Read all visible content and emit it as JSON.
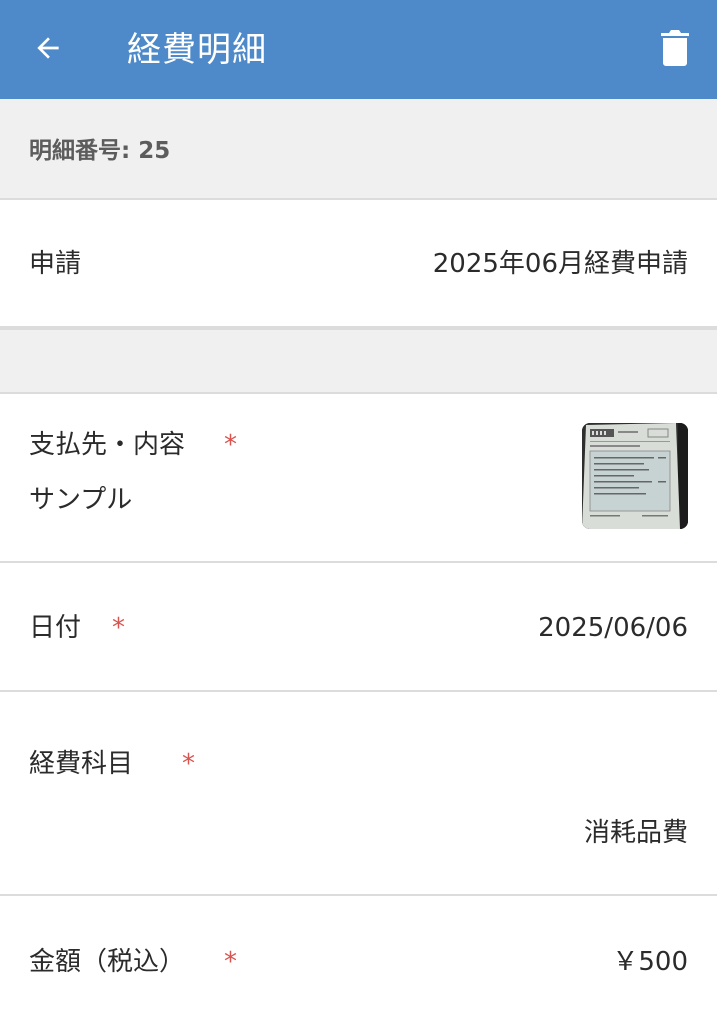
{
  "appbar": {
    "title": "経費明細",
    "back_icon": "arrow-left-icon",
    "delete_icon": "trash-icon",
    "color": "#4e8ac9"
  },
  "detail_number": "明細番号: 25",
  "application": {
    "label": "申請",
    "value": "2025年06月経費申請"
  },
  "payee": {
    "label": "支払先・内容",
    "required_mark": "*",
    "value": "サンプル",
    "receipt_thumbnail": "receipt-image"
  },
  "date": {
    "label": "日付",
    "required_mark": "*",
    "value": "2025/06/06"
  },
  "category": {
    "label": "経費科目",
    "required_mark": "*",
    "value": "消耗品費"
  },
  "amount": {
    "label": "金額（税込）",
    "required_mark": "*",
    "value": "￥500"
  }
}
